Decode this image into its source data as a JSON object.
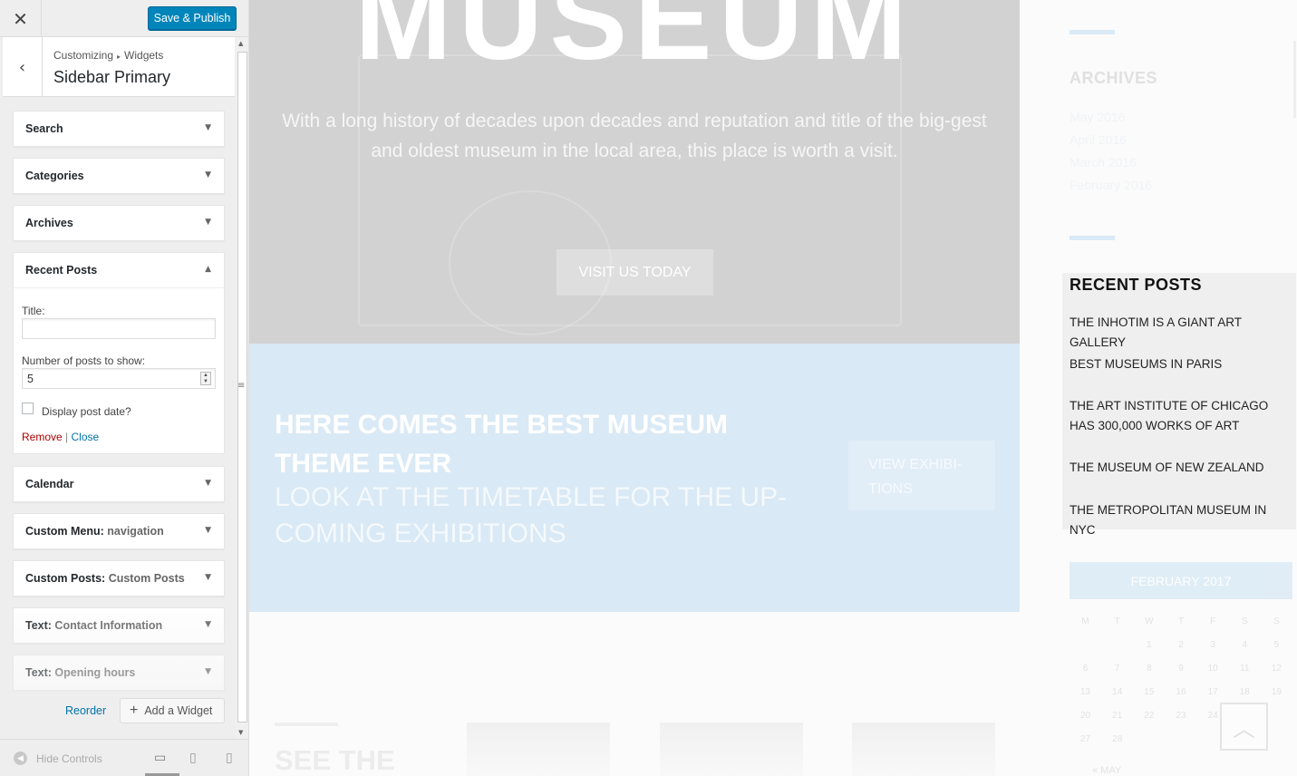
{
  "topbar": {
    "close_glyph": "✕",
    "publish_label": "Save & Publish"
  },
  "section": {
    "back_glyph": "‹",
    "breadcrumb": [
      "Customizing",
      "Widgets"
    ],
    "breadcrumb_sep": "▸",
    "title": "Sidebar Primary"
  },
  "widgets": [
    {
      "title": "Search",
      "sub": ""
    },
    {
      "title": "Categories",
      "sub": ""
    },
    {
      "title": "Archives",
      "sub": ""
    },
    {
      "title": "Recent Posts",
      "sub": ""
    },
    {
      "title": "Calendar",
      "sub": ""
    },
    {
      "title": "Custom Menu:",
      "sub": "navigation"
    },
    {
      "title": "Custom Posts:",
      "sub": "Custom Posts"
    },
    {
      "title": "Text:",
      "sub": "Contact Information"
    },
    {
      "title": "Text:",
      "sub": "Opening hours"
    }
  ],
  "arrows": {
    "collapsed": "▼",
    "expanded": "▲"
  },
  "recent_posts_form": {
    "title_label": "Title:",
    "title_value": "",
    "number_label": "Number of posts to show:",
    "number_value": "5",
    "checkbox_label": "Display post date?",
    "checkbox_checked": false,
    "remove_label": "Remove",
    "separator": "|",
    "close_label": "Close"
  },
  "actions": {
    "reorder_label": "Reorder",
    "add_widget_label": "Add a Widget",
    "add_icon": "+"
  },
  "footer": {
    "hide_controls_label": "Hide Controls",
    "hide_icon": "◀",
    "devices": [
      "desktop-icon",
      "tablet-icon",
      "mobile-icon"
    ]
  },
  "preview": {
    "hero_word": "MUSEUM",
    "hero_text": "With a long history of decades upon decades and reputation and title of the big-gest and oldest museum in the local area, this place is worth a visit.",
    "visit_button": "VISIT US TODAY",
    "band_heading": "HERE COMES THE BEST MUSEUM THEME EVER",
    "band_sub": "LOOK AT THE TIMETABLE FOR THE UP-COMING EXHIBITIONS",
    "exhibitions_button": "VIEW EXHIBI-TIONS",
    "see_the": "SEE THE",
    "archives_heading": "ARCHIVES",
    "archives": [
      "May 2016",
      "April 2016",
      "March 2016",
      "February 2016"
    ],
    "recent_posts_heading": "RECENT POSTS",
    "recent_posts": [
      "THE INHOTIM IS A GIANT ART GALLERY",
      "BEST MUSEUMS IN PARIS",
      "THE ART INSTITUTE OF CHICAGO HAS 300,000 WORKS OF ART",
      "THE MUSEUM OF NEW ZEALAND",
      "THE METROPOLITAN MUSEUM IN NYC"
    ],
    "calendar_month": "FEBRUARY 2017",
    "calendar_days": [
      "M",
      "T",
      "W",
      "T",
      "F",
      "S",
      "S"
    ],
    "calendar_rows": [
      [
        "",
        "",
        "1",
        "2",
        "3",
        "4",
        "5"
      ],
      [
        "6",
        "7",
        "8",
        "9",
        "10",
        "11",
        "12"
      ],
      [
        "13",
        "14",
        "15",
        "16",
        "17",
        "18",
        "19"
      ],
      [
        "20",
        "21",
        "22",
        "23",
        "24",
        "",
        ""
      ],
      [
        "27",
        "28",
        "",
        "",
        "",
        "",
        ""
      ]
    ],
    "calendar_prev": "« MAY",
    "to_top_glyph": "︿"
  },
  "colors": {
    "primary_button": "#0085ba",
    "link": "#0073aa",
    "remove": "#aa0000",
    "accent": "#d9eaf6"
  }
}
